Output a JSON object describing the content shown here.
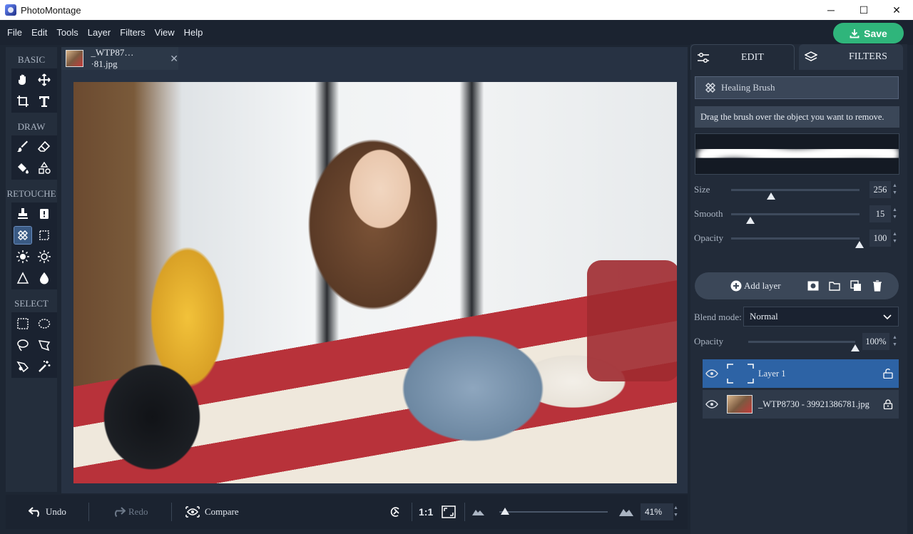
{
  "app": {
    "title": "PhotoMontage"
  },
  "window": {
    "minimize": "─",
    "maximize": "☐",
    "close": "✕"
  },
  "menu": [
    "File",
    "Edit",
    "Tools",
    "Layer",
    "Filters",
    "View",
    "Help"
  ],
  "save_label": "Save",
  "toolbar": {
    "sections": [
      "BASIC",
      "DRAW",
      "RETOUCHE",
      "SELECT"
    ],
    "active_tool": "healing-brush"
  },
  "document": {
    "tab_name": "_WTP87…·81.jpg",
    "close": "✕"
  },
  "bottom": {
    "undo": "Undo",
    "redo": "Redo",
    "compare": "Compare",
    "actual_size": "1:1",
    "zoom": "41%",
    "zoom_fraction": 0.0
  },
  "panel": {
    "tabs": {
      "edit": "EDIT",
      "filters": "FILTERS"
    },
    "tool_name": "Healing Brush",
    "hint": "Drag the brush over the object you want to remove.",
    "sliders": {
      "size": {
        "label": "Size",
        "value": "256",
        "fraction": 0.31
      },
      "smooth": {
        "label": "Smooth",
        "value": "15",
        "fraction": 0.15
      },
      "opacity": {
        "label": "Opacity",
        "value": "100",
        "fraction": 1.0
      }
    },
    "add_layer": "Add layer",
    "blend_label": "Blend mode:",
    "blend_value": "Normal",
    "layer_opacity": {
      "label": "Opacity",
      "value": "100%",
      "fraction": 1.0
    },
    "layers": [
      {
        "name": "Layer 1",
        "selected": true
      },
      {
        "name": "_WTP8730 - 39921386781.jpg",
        "selected": false
      }
    ]
  },
  "colors": {
    "accent": "#2fb57b",
    "selection": "#2d63a5",
    "background": "#1d2633"
  }
}
